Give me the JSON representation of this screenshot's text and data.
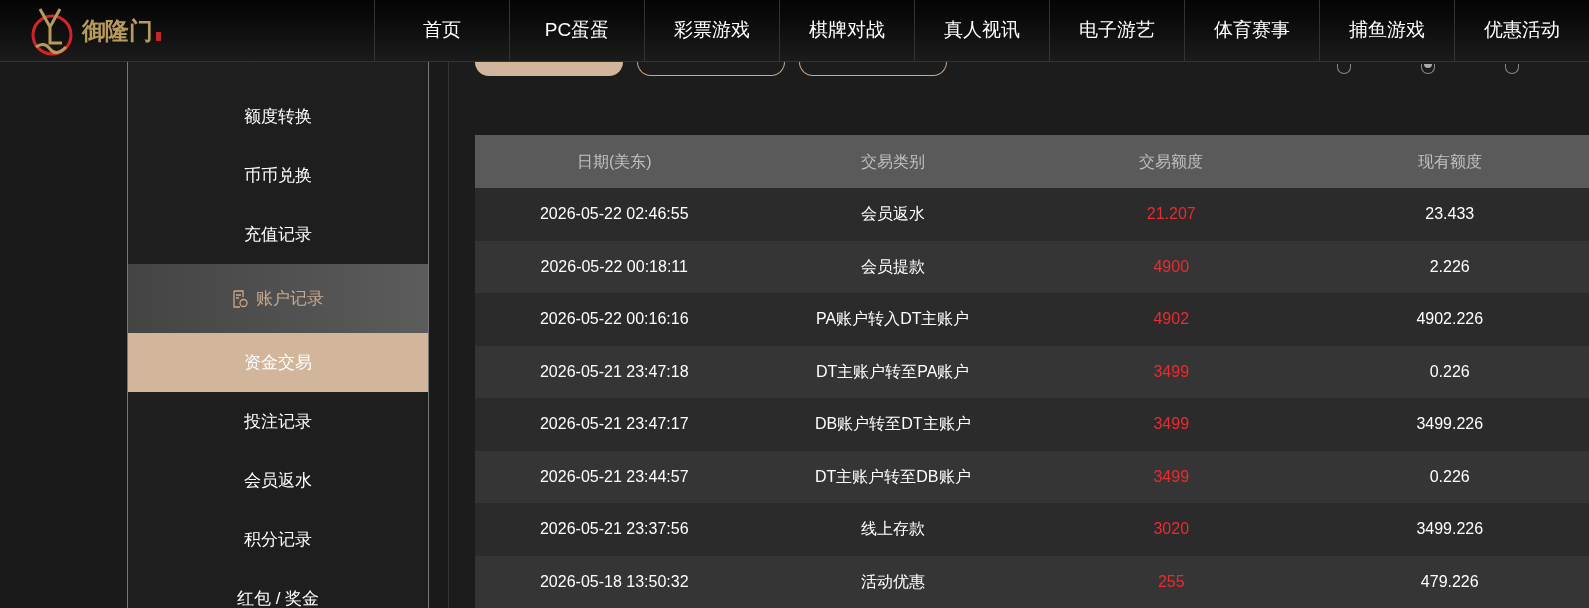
{
  "logo": {
    "name": "御隆门"
  },
  "nav": [
    {
      "label": "首页"
    },
    {
      "label": "PC蛋蛋"
    },
    {
      "label": "彩票游戏"
    },
    {
      "label": "棋牌对战"
    },
    {
      "label": "真人视讯"
    },
    {
      "label": "电子游艺"
    },
    {
      "label": "体育赛事"
    },
    {
      "label": "捕鱼游戏"
    },
    {
      "label": "优惠活动"
    }
  ],
  "filters": [
    {
      "selected": true
    },
    {
      "selected": false
    },
    {
      "selected": false
    }
  ],
  "range_options": [
    {
      "selected": false
    },
    {
      "selected": true
    },
    {
      "selected": false
    }
  ],
  "sidebar": {
    "items": [
      {
        "kind": "item",
        "label": "额度转换",
        "selected": false
      },
      {
        "kind": "item",
        "label": "币币兑换",
        "selected": false
      },
      {
        "kind": "item",
        "label": "充值记录",
        "selected": false
      },
      {
        "kind": "group",
        "label": "账户记录",
        "children": [
          {
            "kind": "item",
            "label": "资金交易",
            "selected": true
          },
          {
            "kind": "item",
            "label": "投注记录",
            "selected": false
          },
          {
            "kind": "item",
            "label": "会员返水",
            "selected": false
          },
          {
            "kind": "item",
            "label": "积分记录",
            "selected": false
          },
          {
            "kind": "item",
            "label": "红包 / 奖金",
            "selected": false
          }
        ]
      }
    ]
  },
  "table": {
    "columns": [
      "日期(美东)",
      "交易类别",
      "交易额度",
      "现有额度"
    ],
    "rows": [
      [
        "2026-05-22 02:46:55",
        "会员返水",
        "21.207",
        "23.433"
      ],
      [
        "2026-05-22 00:18:11",
        "会员提款",
        "4900",
        "2.226"
      ],
      [
        "2026-05-22 00:16:16",
        "PA账户转入DT主账户",
        "4902",
        "4902.226"
      ],
      [
        "2026-05-21 23:47:18",
        "DT主账户转至PA账户",
        "3499",
        "0.226"
      ],
      [
        "2026-05-21 23:47:17",
        "DB账户转至DT主账户",
        "3499",
        "3499.226"
      ],
      [
        "2026-05-21 23:44:57",
        "DT主账户转至DB账户",
        "3499",
        "0.226"
      ],
      [
        "2026-05-21 23:37:56",
        "线上存款",
        "3020",
        "3499.226"
      ],
      [
        "2026-05-18 13:50:32",
        "活动优惠",
        "255",
        "479.226"
      ]
    ]
  }
}
